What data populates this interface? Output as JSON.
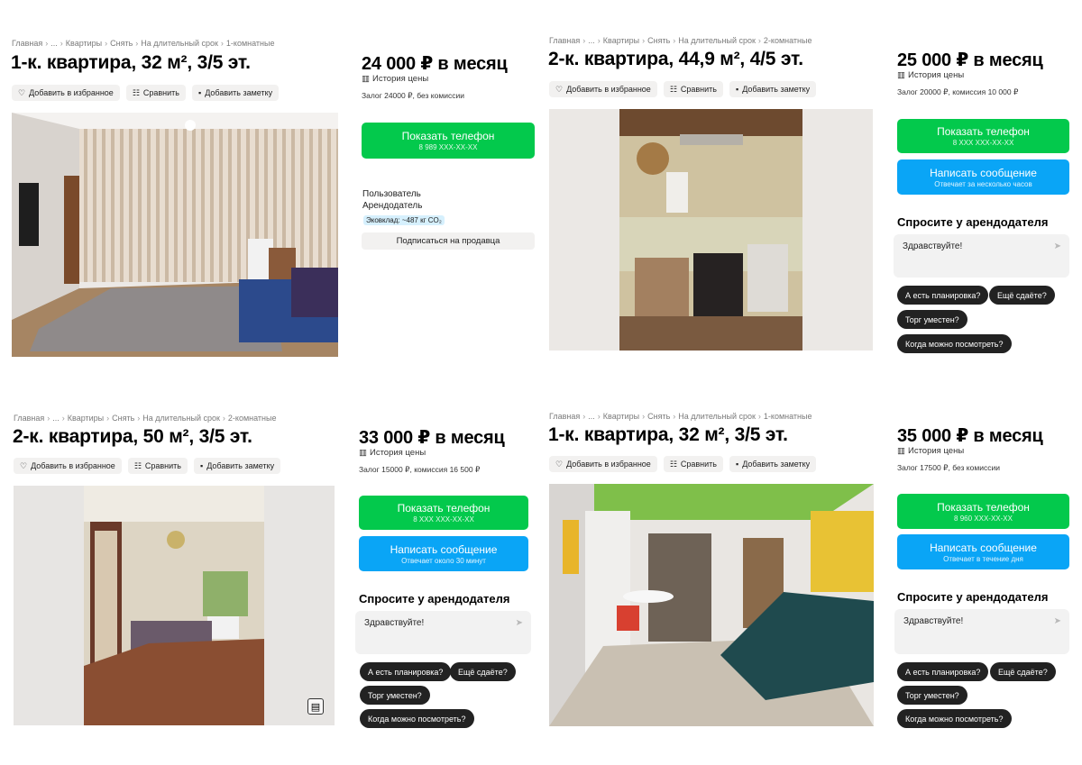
{
  "ui": {
    "fav": "Добавить в избранное",
    "compare": "Сравнить",
    "note": "Добавить заметку",
    "show_phone": "Показать телефон",
    "write_msg": "Написать сообщение",
    "price_history": "История цены",
    "ask_title": "Спросите у арендодателя",
    "greeting": "Здравствуйте!",
    "chips": [
      "А есть планировка?",
      "Ещё сдаёте?",
      "Торг уместен?",
      "Когда можно посмотреть?"
    ],
    "breadcrumb_common": [
      "Главная",
      "...",
      "Квартиры",
      "Снять",
      "На длительный срок"
    ]
  },
  "listings": [
    {
      "crumb_last": "1-комнатные",
      "title": "1-к. квартира, 32 м², 3/5 эт.",
      "price": "24 000 ₽ в месяц",
      "deposit": "Залог 24000 ₽, без комиссии",
      "phone": "8 989 ХХХ-ХХ-ХХ",
      "seller_type": "Пользователь",
      "seller_role": "Арендодатель",
      "eco": "Эковклад: ~487 кг CO₂",
      "subscribe": "Подписаться на продавца"
    },
    {
      "crumb_last": "2-комнатные",
      "title": "2-к. квартира, 44,9 м², 4/5 эт.",
      "price": "25 000 ₽ в месяц",
      "deposit": "Залог 20000 ₽, комиссия 10 000 ₽",
      "phone": "8 ХХХ ХХХ-ХХ-ХХ",
      "msg_sub": "Отвечает за несколько часов"
    },
    {
      "crumb_last": "2-комнатные",
      "title": "2-к. квартира, 50 м², 3/5 эт.",
      "price": "33 000 ₽ в месяц",
      "deposit": "Залог 15000 ₽, комиссия 16 500 ₽",
      "phone": "8 ХХХ ХХХ-ХХ-ХХ",
      "msg_sub": "Отвечает около 30 минут"
    },
    {
      "crumb_last": "1-комнатные",
      "title": "1-к. квартира, 32 м², 3/5 эт.",
      "price": "35 000 ₽ в месяц",
      "deposit": "Залог 17500 ₽, без комиссии",
      "phone": "8 960 ХХХ-ХХ-ХХ",
      "msg_sub": "Отвечает в течение дня"
    }
  ]
}
